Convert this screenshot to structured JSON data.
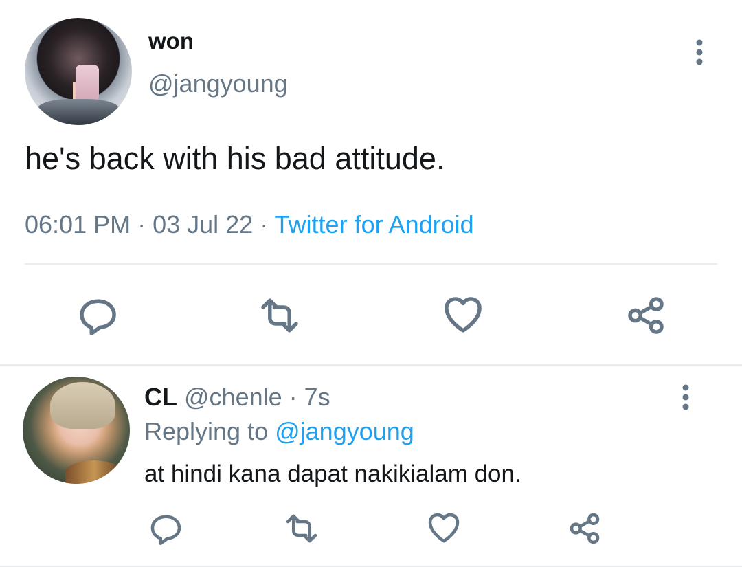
{
  "tweet": {
    "author_name": "won",
    "author_handle": "@jangyoung",
    "text": "he's back with his bad attitude.",
    "time": "06:01 PM",
    "date": "03 Jul 22",
    "separator": " · ",
    "source": "Twitter for Android",
    "icons": {
      "more": "more-vertical-icon",
      "reply": "reply-icon",
      "retweet": "retweet-icon",
      "like": "heart-icon",
      "share": "share-icon"
    }
  },
  "reply": {
    "author_name": "CL",
    "author_handle": "@chenle",
    "separator": " · ",
    "age": "7s",
    "replying_prefix": "Replying to ",
    "replying_handle": "@jangyoung",
    "text": "at hindi kana dapat nakikialam don.",
    "icons": {
      "more": "more-vertical-icon",
      "reply": "reply-icon",
      "retweet": "retweet-icon",
      "like": "heart-icon",
      "share": "share-icon"
    }
  },
  "colors": {
    "text_primary": "#14171a",
    "text_secondary": "#657786",
    "link": "#1da1f2",
    "divider": "#e6ecf0",
    "icon": "#657786"
  }
}
